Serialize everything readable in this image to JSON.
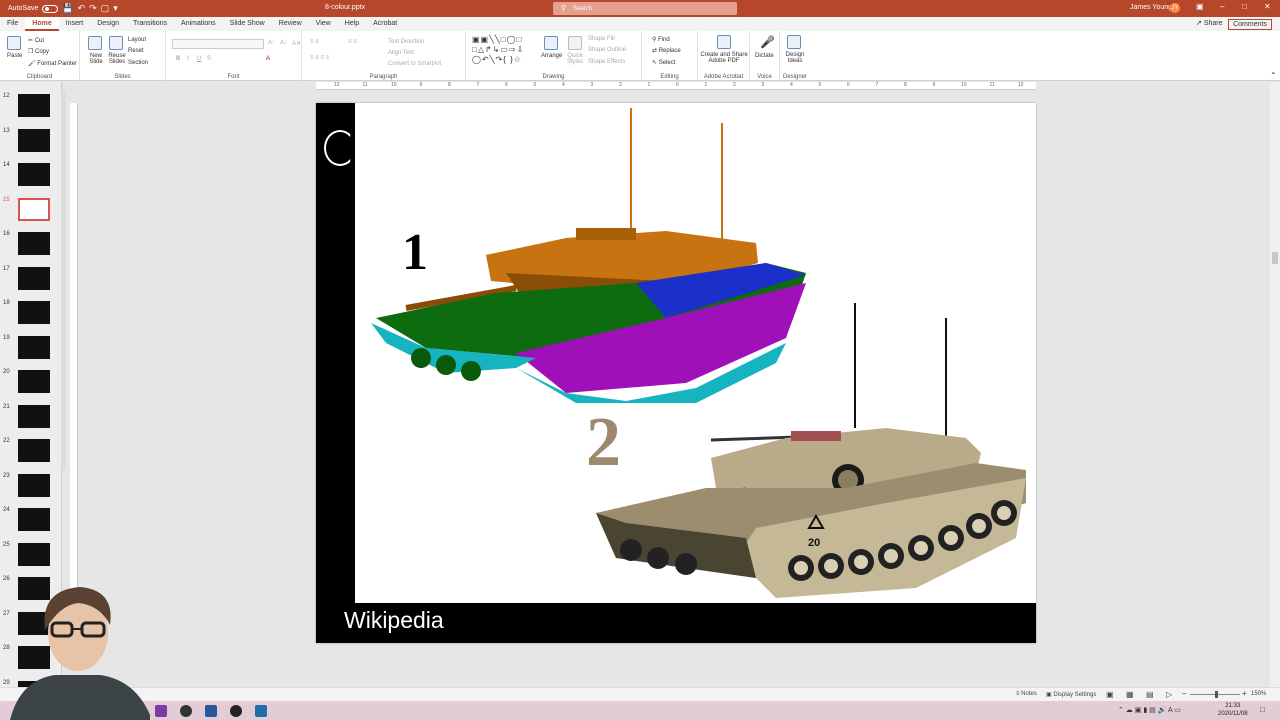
{
  "titlebar": {
    "autosave_label": "AutoSave",
    "filename": "8-colour.pptx",
    "search_placeholder": "Search",
    "user_name": "James Young",
    "user_initial": "JY"
  },
  "tabs": [
    "File",
    "Home",
    "Insert",
    "Design",
    "Transitions",
    "Animations",
    "Slide Show",
    "Review",
    "View",
    "Help",
    "Acrobat"
  ],
  "share_label": "Share",
  "comments_label": "Comments",
  "ribbon": {
    "clipboard": {
      "paste": "Paste",
      "cut": "Cut",
      "copy": "Copy",
      "format_painter": "Format Painter",
      "label": "Clipboard"
    },
    "slides": {
      "new_slide": "New Slide",
      "reuse_slides": "Reuse Slides",
      "layout": "Layout",
      "reset": "Reset",
      "section": "Section",
      "label": "Slides"
    },
    "font": {
      "label": "Font",
      "bold": "B",
      "italic": "I",
      "underline": "U",
      "strike": "S"
    },
    "paragraph": {
      "text_direction": "Text Direction",
      "align_text": "Align Text",
      "convert_smartart": "Convert to SmartArt",
      "label": "Paragraph"
    },
    "drawing": {
      "arrange": "Arrange",
      "quick_styles": "Quick Styles",
      "shape_fill": "Shape Fill",
      "shape_outline": "Shape Outline",
      "shape_effects": "Shape Effects",
      "label": "Drawing"
    },
    "editing": {
      "find": "Find",
      "replace": "Replace",
      "select": "Select",
      "label": "Editing"
    },
    "adobe": {
      "create_share": "Create and Share Adobe PDF",
      "label": "Adobe Acrobat"
    },
    "voice": {
      "dictate": "Dictate",
      "label": "Voice"
    },
    "designer": {
      "design_ideas": "Design Ideas",
      "label": "Designer"
    }
  },
  "ruler_ticks": [
    "12",
    "11",
    "10",
    "9",
    "8",
    "7",
    "6",
    "5",
    "4",
    "3",
    "2",
    "1",
    "0",
    "1",
    "2",
    "3",
    "4",
    "5",
    "6",
    "7",
    "8",
    "9",
    "10",
    "11",
    "12"
  ],
  "slide_numbers": [
    "12",
    "13",
    "14",
    "15",
    "16",
    "17",
    "18",
    "19",
    "20",
    "21",
    "22",
    "23",
    "24",
    "25",
    "26",
    "27",
    "28",
    "29"
  ],
  "selected_slide": "15",
  "slide": {
    "label_1": "1",
    "label_2": "2",
    "caption": "Wikipedia",
    "tank_marking": "20"
  },
  "statusbar": {
    "notes": "Notes",
    "display_settings": "Display Settings",
    "zoom": "150%"
  },
  "clock": {
    "time": "21:33",
    "date": "2020/11/08"
  },
  "colors": {
    "accent": "#b7472a",
    "tank1_turret": "#c87311",
    "tank1_hull_green": "#0d6b10",
    "tank1_hull_blue": "#1b30c8",
    "tank1_tracks": "#a010b8",
    "tank1_skirt": "#16b3c0",
    "tank2_body": "#b9ab8a"
  }
}
